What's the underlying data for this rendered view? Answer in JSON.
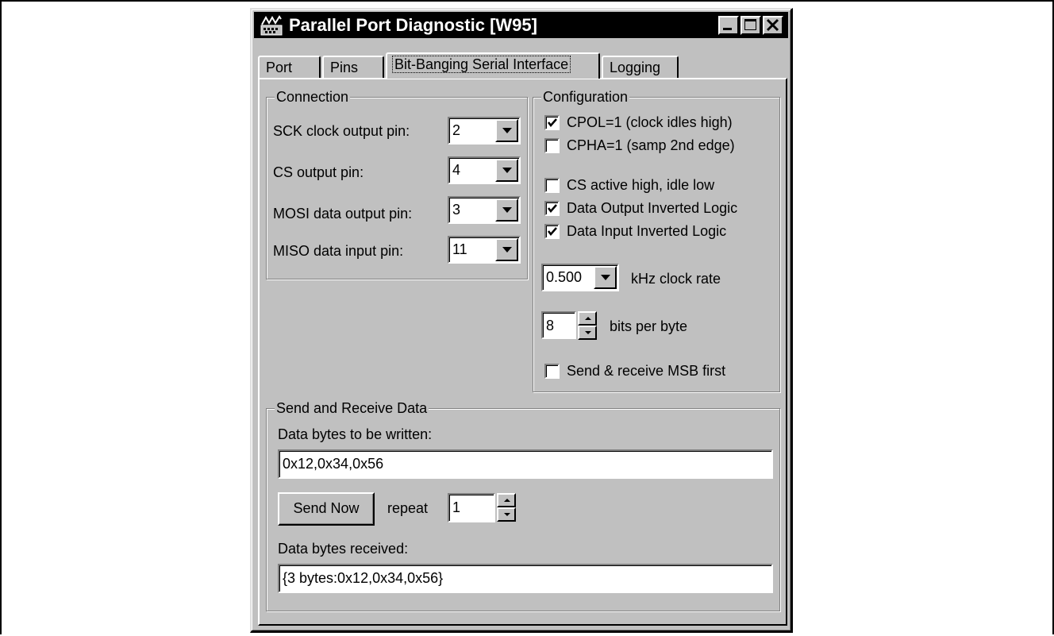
{
  "window": {
    "title": "Parallel Port Diagnostic [W95]"
  },
  "tabs": [
    {
      "label": "Port"
    },
    {
      "label": "Pins"
    },
    {
      "label": "Bit-Banging Serial Interface"
    },
    {
      "label": "Logging"
    }
  ],
  "connection": {
    "title": "Connection",
    "sck_label": "SCK clock output pin:",
    "sck_value": "2",
    "cs_label": "CS output pin:",
    "cs_value": "4",
    "mosi_label": "MOSI data output pin:",
    "mosi_value": "3",
    "miso_label": "MISO data input pin:",
    "miso_value": "11"
  },
  "configuration": {
    "title": "Configuration",
    "checkboxes": [
      {
        "label": "CPOL=1 (clock idles high)",
        "checked": true
      },
      {
        "label": "CPHA=1 (samp 2nd edge)",
        "checked": false
      },
      {
        "label": "CS active high, idle low",
        "checked": false
      },
      {
        "label": "Data Output Inverted Logic",
        "checked": true
      },
      {
        "label": "Data Input Inverted Logic",
        "checked": true
      }
    ],
    "clock_rate_value": "0.500",
    "clock_rate_label": "kHz clock rate",
    "bits_value": "8",
    "bits_label": "bits per byte",
    "msb_label": "Send & receive MSB first",
    "msb_checked": false
  },
  "send_receive": {
    "title": "Send and Receive Data",
    "write_label": "Data bytes to be written:",
    "write_value": "0x12,0x34,0x56",
    "send_button": "Send Now",
    "repeat_label": "repeat",
    "repeat_value": "1",
    "received_label": "Data bytes received:",
    "received_value": "{3 bytes:0x12,0x34,0x56}"
  },
  "icons": {
    "app": "parallel-port-icon",
    "minimize": "minimize-icon",
    "maximize": "maximize-icon",
    "close": "close-icon",
    "dropdown": "chevron-down-icon",
    "check": "checkmark-icon",
    "spin_up": "spin-up-icon",
    "spin_down": "spin-down-icon"
  }
}
